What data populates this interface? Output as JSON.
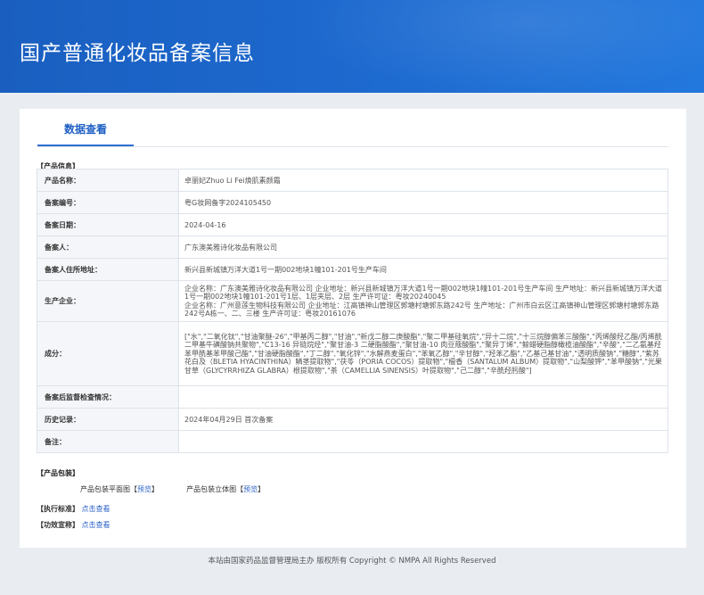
{
  "banner": {
    "title": "国产普通化妆品备案信息"
  },
  "tabs": {
    "data_view": "数据查看"
  },
  "product_info": {
    "section_title": "【产品信息】",
    "rows": [
      {
        "label": "产品名称：",
        "value": "卓丽妃Zhuo Li Fei焕肌素颜霜"
      },
      {
        "label": "备案编号：",
        "value": "粤G妆网备字2024105450"
      },
      {
        "label": "备案日期：",
        "value": "2024-04-16"
      },
      {
        "label": "备案人：",
        "value": "广东澳美雅诗化妆品有限公司"
      },
      {
        "label": "备案人住所地址：",
        "value": "新兴县新城镇万洋大道1号一期002地块1幢101-201号生产车间"
      },
      {
        "label": "生产企业：",
        "value": "企业名称：广东澳美雅诗化妆品有限公司 企业地址：新兴县新城镇万洋大道1号一期002地块1幢101-201号生产车间 生产地址：新兴县新城镇万洋大道1号一期002地块1幢101-201号1层、1层夹层、2层 生产许可证：粤妆20240045\n企业名称：广州意莲生物科技有限公司 企业地址：江高镇神山管理区郭塘村塘郭东路242号 生产地址：广州市白云区江高镇神山管理区郭塘村塘郭东路242号A栋一、二、三楼 生产许可证：粤妆20161076"
      },
      {
        "label": "成分：",
        "value": "[\"水\",\"二氧化钛\",\"甘油聚醚-26\",\"甲基丙二醇\",\"甘油\",\"新戊二醇二庚酸酯\",\"聚二甲基硅氧烷\",\"异十二烷\",\"十三烷醇偏苯三酸酯\",\"丙烯酸羟乙酯/丙烯酰二甲基牛磺酸钠共聚物\",\"C13-16 异链烷烃\",\"聚甘油-3 二硬脂酸酯\",\"聚甘油-10 肉豆蔻酸酯\",\"聚异丁烯\",\"鲸蜡硬脂醇橄榄油酸酯\",\"辛酸\",\"二乙氨基羟苯甲酰基苯甲酸己酯\",\"甘油硬脂酸酯\",\"丁二醇\",\"氧化锌\",\"水解燕麦蛋白\",\"苯氧乙醇\",\"辛甘醇\",\"羟苯乙酯\",\"乙基己基甘油\",\"透明质酸钠\",\"糖醇\",\"紫苏花白及（BLETIA HYACINTHINA）鳞茎提取物\",\"茯苓（PORIA COCOS）提取物\",\"檀香（SANTALUM ALBUM）提取物\",\"山梨酸钾\",\"苯甲酸钠\",\"光果甘草（GLYCYRRHIZA GLABRA）根提取物\",\"茶（CAMELLIA SINENSIS）叶提取物\",\"己二醇\",\"辛酰羟肟酸\"]"
      },
      {
        "label": "备案后监督检查情况：",
        "value": ""
      },
      {
        "label": "历史记录：",
        "value": "2024年04月29日 首次备案"
      },
      {
        "label": "备注：",
        "value": ""
      }
    ]
  },
  "packaging": {
    "section_title": "【产品包装】",
    "flat_label": "产品包装平面图",
    "flat_link": "预览",
    "solid_label": "产品包装立体图",
    "solid_link": "预览",
    "bracket_open": "【",
    "bracket_close": "】"
  },
  "standard": {
    "label": "【执行标准】",
    "link": "点击查看"
  },
  "efficacy": {
    "label": "【功效宣称】",
    "link": "点击查看"
  },
  "footer": {
    "text": "本站由国家药品监督管理局主办 版权所有 Copyright © NMPA All Rights Reserved"
  },
  "colors": {
    "banner": "#1d6ad0",
    "accent": "#2e6fd1",
    "link": "#2b62c9"
  }
}
